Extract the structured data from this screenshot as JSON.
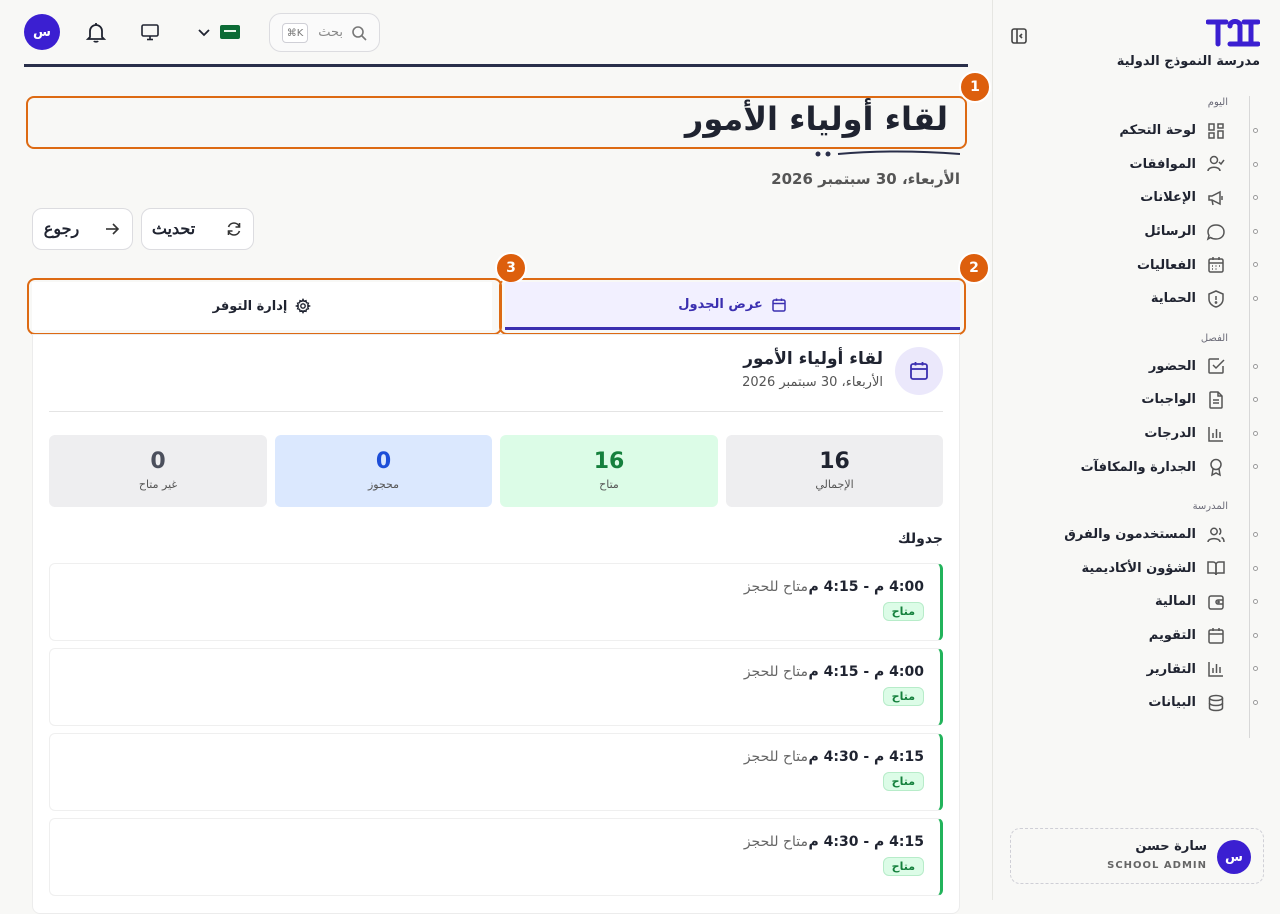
{
  "sidebar": {
    "brand_name": "مدرسة النموذج الدولية",
    "sections": [
      {
        "title": "اليوم",
        "items": [
          {
            "label": "لوحة التحكم",
            "icon": "dashboard-icon"
          },
          {
            "label": "الموافقات",
            "icon": "user-check-icon"
          },
          {
            "label": "الإعلانات",
            "icon": "megaphone-icon"
          },
          {
            "label": "الرسائل",
            "icon": "message-icon"
          },
          {
            "label": "الفعاليات",
            "icon": "calendar-icon"
          },
          {
            "label": "الحماية",
            "icon": "shield-icon"
          }
        ]
      },
      {
        "title": "الفصل",
        "items": [
          {
            "label": "الحضور",
            "icon": "check-square-icon"
          },
          {
            "label": "الواجبات",
            "icon": "file-text-icon"
          },
          {
            "label": "الدرجات",
            "icon": "bar-chart-icon"
          },
          {
            "label": "الجدارة والمكافآت",
            "icon": "award-icon"
          }
        ]
      },
      {
        "title": "المدرسة",
        "items": [
          {
            "label": "المستخدمون والفرق",
            "icon": "users-icon"
          },
          {
            "label": "الشؤون الأكاديمية",
            "icon": "book-icon"
          },
          {
            "label": "المالية",
            "icon": "wallet-icon"
          },
          {
            "label": "التقويم",
            "icon": "calendar-icon"
          },
          {
            "label": "التقارير",
            "icon": "bar-chart-icon"
          },
          {
            "label": "البيانات",
            "icon": "database-icon"
          }
        ]
      }
    ],
    "user": {
      "initial": "س",
      "name": "سارة حسن",
      "role": "SCHOOL ADMIN"
    }
  },
  "topbar": {
    "avatar_initial": "س",
    "search_placeholder": "بحث",
    "search_shortcut": "K⌘"
  },
  "page": {
    "title": "لقاء أولياء الأمور",
    "date": "الأربعاء، 30 سبتمبر 2026",
    "refresh_label": "تحديث",
    "back_label": "رجوع"
  },
  "tabs": [
    {
      "label": "عرض الجدول",
      "active": true
    },
    {
      "label": "إدارة التوفر",
      "active": false
    }
  ],
  "callouts": [
    "1",
    "2",
    "3"
  ],
  "card": {
    "title": "لقاء أولياء الأمور",
    "date": "الأربعاء، 30 سبتمبر 2026",
    "stats": [
      {
        "value": "16",
        "label": "الإجمالي"
      },
      {
        "value": "16",
        "label": "متاح"
      },
      {
        "value": "0",
        "label": "محجوز"
      },
      {
        "value": "0",
        "label": "غير متاح"
      }
    ],
    "schedule_label": "جدولك",
    "slots": [
      {
        "time": "4:00 م - 4:15 م",
        "status": "متاح للحجز",
        "badge": "متاح"
      },
      {
        "time": "4:00 م - 4:15 م",
        "status": "متاح للحجز",
        "badge": "متاح"
      },
      {
        "time": "4:15 م - 4:30 م",
        "status": "متاح للحجز",
        "badge": "متاح"
      },
      {
        "time": "4:15 م - 4:30 م",
        "status": "متاح للحجز",
        "badge": "متاح"
      }
    ]
  },
  "colors": {
    "accent": "#3b2fb0",
    "callout": "#dd6a13",
    "available_green": "#15803d",
    "booked_blue": "#1d4ed8"
  }
}
